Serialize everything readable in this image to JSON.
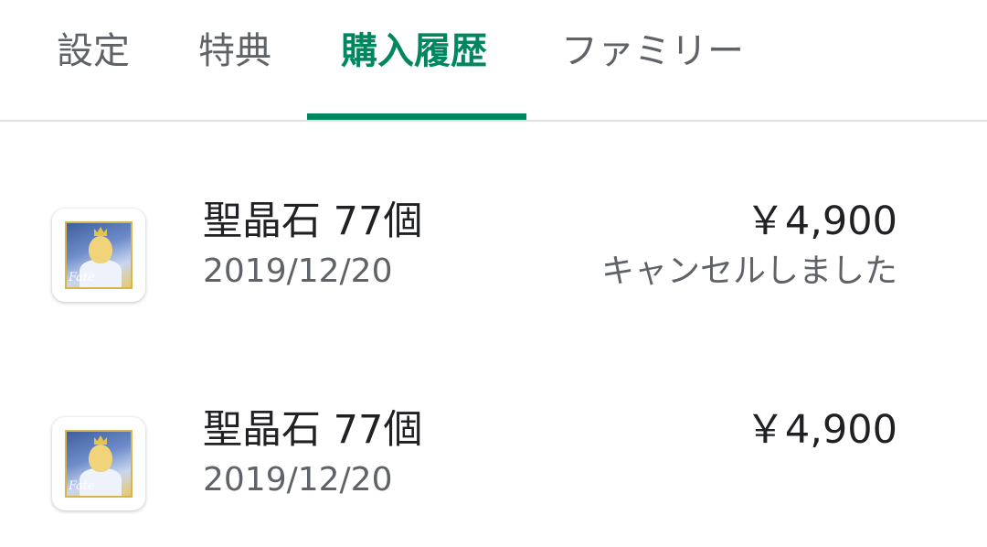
{
  "tabs": [
    {
      "label": "設定"
    },
    {
      "label": "特典"
    },
    {
      "label": "購入履歴"
    },
    {
      "label": "ファミリー"
    }
  ],
  "active_tab": "購入履歴",
  "accent_color": "#01875f",
  "purchases": [
    {
      "icon": "fate-grand-order-app-icon",
      "icon_logo_text": "Fate",
      "title": "聖晶石 77個",
      "date": "2019/12/20",
      "price": "￥4,900",
      "status": "キャンセルしました"
    },
    {
      "icon": "fate-grand-order-app-icon",
      "icon_logo_text": "Fate",
      "title": "聖晶石 77個",
      "date": "2019/12/20",
      "price": "￥4,900",
      "status": ""
    }
  ]
}
